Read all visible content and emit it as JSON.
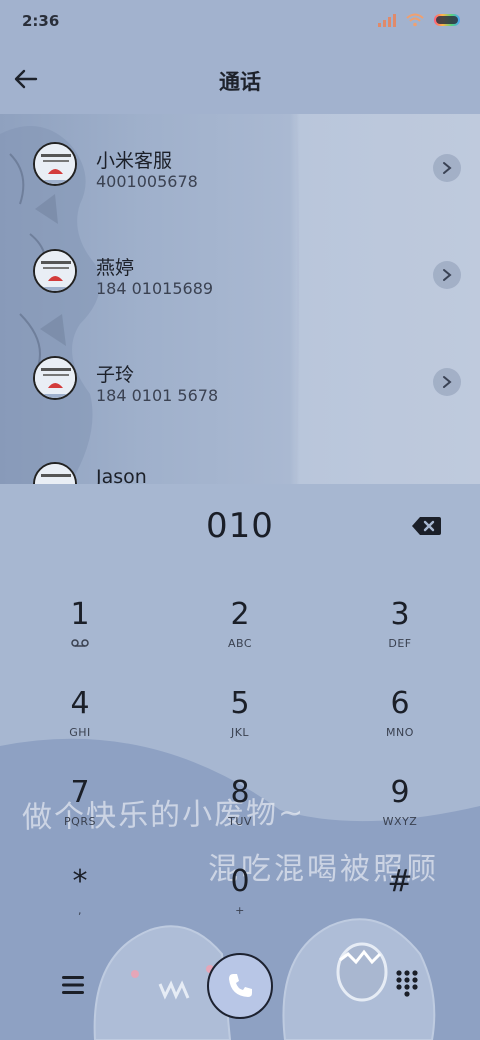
{
  "status_bar": {
    "time": "2:36"
  },
  "header": {
    "title": "通话"
  },
  "contacts": [
    {
      "name": "小米客服",
      "number": "4001005678"
    },
    {
      "name": "燕婷",
      "number": "184 01015689"
    },
    {
      "name": "子玲",
      "number": "184 0101 5678"
    },
    {
      "name": "Jason",
      "number": ""
    }
  ],
  "dialer": {
    "input": "010",
    "keys": [
      {
        "digit": "1",
        "letters": ""
      },
      {
        "digit": "2",
        "letters": "ABC"
      },
      {
        "digit": "3",
        "letters": "DEF"
      },
      {
        "digit": "4",
        "letters": "GHI"
      },
      {
        "digit": "5",
        "letters": "JKL"
      },
      {
        "digit": "6",
        "letters": "MNO"
      },
      {
        "digit": "7",
        "letters": "PQRS"
      },
      {
        "digit": "8",
        "letters": "TUV"
      },
      {
        "digit": "9",
        "letters": "WXYZ"
      },
      {
        "digit": "*",
        "letters": ","
      },
      {
        "digit": "0",
        "letters": "+"
      },
      {
        "digit": "#",
        "letters": ""
      }
    ]
  },
  "theme_text": {
    "line1": "做个快乐的小废物~",
    "line2": "混吃混喝被照顾"
  },
  "icons": {
    "back": "back-arrow-icon",
    "chevron": "chevron-right-icon",
    "backspace": "backspace-icon",
    "voicemail": "voicemail-icon",
    "menu": "menu-icon",
    "call": "phone-icon",
    "keypad": "keypad-icon"
  },
  "colors": {
    "background": "#a7b7d1",
    "call_button": "#b8c6e6"
  }
}
